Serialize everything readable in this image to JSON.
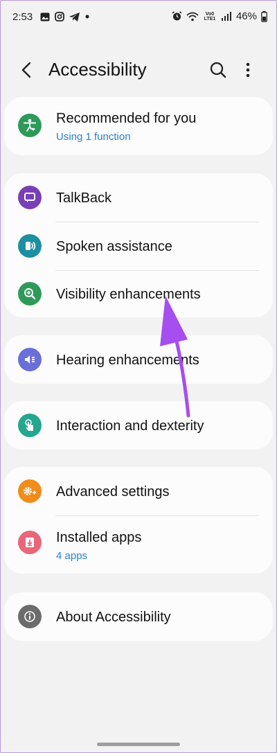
{
  "status_bar": {
    "time": "2:53",
    "battery": "46%",
    "network": "Vo0 LTE1",
    "left_icons": [
      "image-icon",
      "instagram-icon",
      "telegram-icon",
      "dot-icon"
    ],
    "right_icons": [
      "alarm-icon",
      "wifi-icon",
      "signal-icon",
      "battery-icon"
    ]
  },
  "header": {
    "title": "Accessibility",
    "back_icon": "back-arrow-icon",
    "search_icon": "search-icon",
    "more_icon": "more-vert-icon"
  },
  "groups": [
    {
      "items": [
        {
          "label": "Recommended for you",
          "sub": "Using 1 function",
          "icon": "accessibility-person-icon",
          "color": "#2e9a5a"
        }
      ]
    },
    {
      "items": [
        {
          "label": "TalkBack",
          "icon": "talkback-icon",
          "color": "#7a3fb8"
        },
        {
          "label": "Spoken assistance",
          "icon": "spoken-assistance-icon",
          "color": "#1c8fa3"
        },
        {
          "label": "Visibility enhancements",
          "icon": "magnifier-plus-icon",
          "color": "#2e9a5a"
        }
      ]
    },
    {
      "items": [
        {
          "label": "Hearing enhancements",
          "icon": "hearing-icon",
          "color": "#6a6fd8"
        }
      ]
    },
    {
      "items": [
        {
          "label": "Interaction and dexterity",
          "icon": "hand-touch-icon",
          "color": "#24a68f"
        }
      ]
    },
    {
      "items": [
        {
          "label": "Advanced settings",
          "icon": "advanced-gear-icon",
          "color": "#f08c1c"
        },
        {
          "label": "Installed apps",
          "sub": "4 apps",
          "icon": "installed-apps-icon",
          "color": "#e8677a"
        }
      ]
    },
    {
      "items": [
        {
          "label": "About Accessibility",
          "icon": "info-icon",
          "color": "#6c6c6c"
        }
      ]
    }
  ],
  "annotation": {
    "arrow_color": "#a64ef0"
  }
}
